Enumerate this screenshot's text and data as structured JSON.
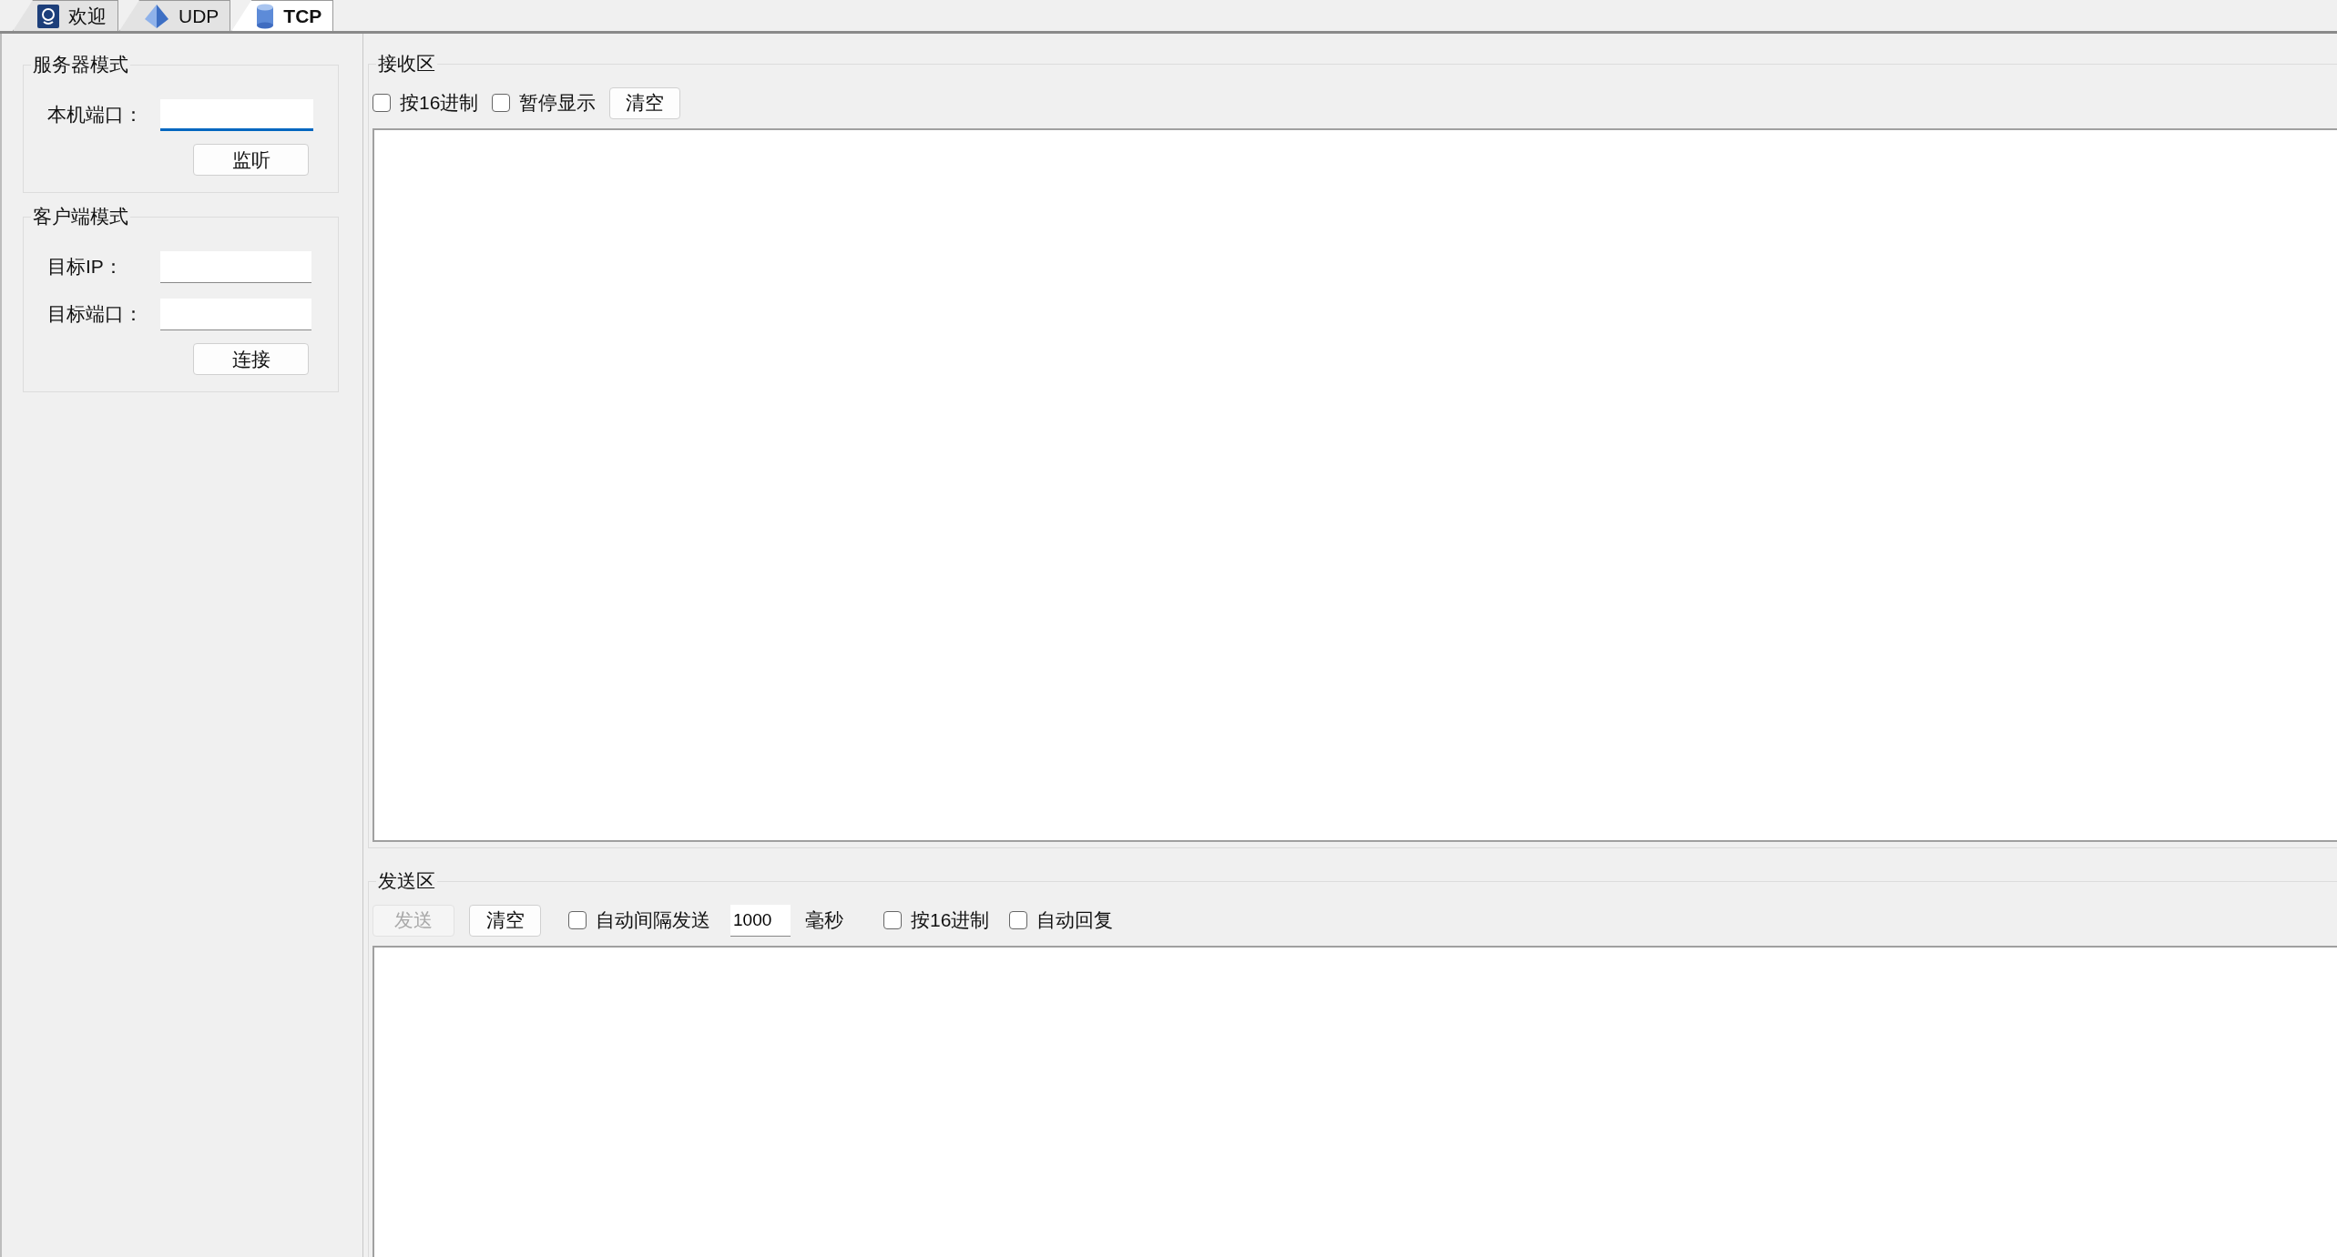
{
  "tabs": [
    {
      "label": "欢迎",
      "kind": "welcome",
      "selected": false
    },
    {
      "label": "UDP",
      "kind": "udp",
      "selected": false
    },
    {
      "label": "TCP",
      "kind": "tcp",
      "selected": true
    }
  ],
  "server_mode": {
    "title": "服务器模式",
    "fields": [
      {
        "label": "本机端口：",
        "focused": true
      }
    ],
    "button": "监听"
  },
  "client_mode": {
    "title": "客户端模式",
    "fields": [
      {
        "label": "目标IP：",
        "focused": false
      },
      {
        "label": "目标端口：",
        "focused": false
      }
    ],
    "button": "连接"
  },
  "receive_area": {
    "title": "接收区",
    "options": [
      {
        "label": "按16进制",
        "checked": false
      },
      {
        "label": "暂停显示",
        "checked": false
      }
    ],
    "clear_button": "清空"
  },
  "send_area": {
    "title": "发送区",
    "send_button": {
      "label": "发送",
      "disabled": true
    },
    "clear_button": "清空",
    "auto_send": {
      "label": "自动间隔发送",
      "checked": false
    },
    "interval": {
      "value": "1000",
      "unit": "毫秒"
    },
    "options": [
      {
        "label": "按16进制",
        "checked": false
      },
      {
        "label": "自动回复",
        "checked": false
      }
    ]
  }
}
